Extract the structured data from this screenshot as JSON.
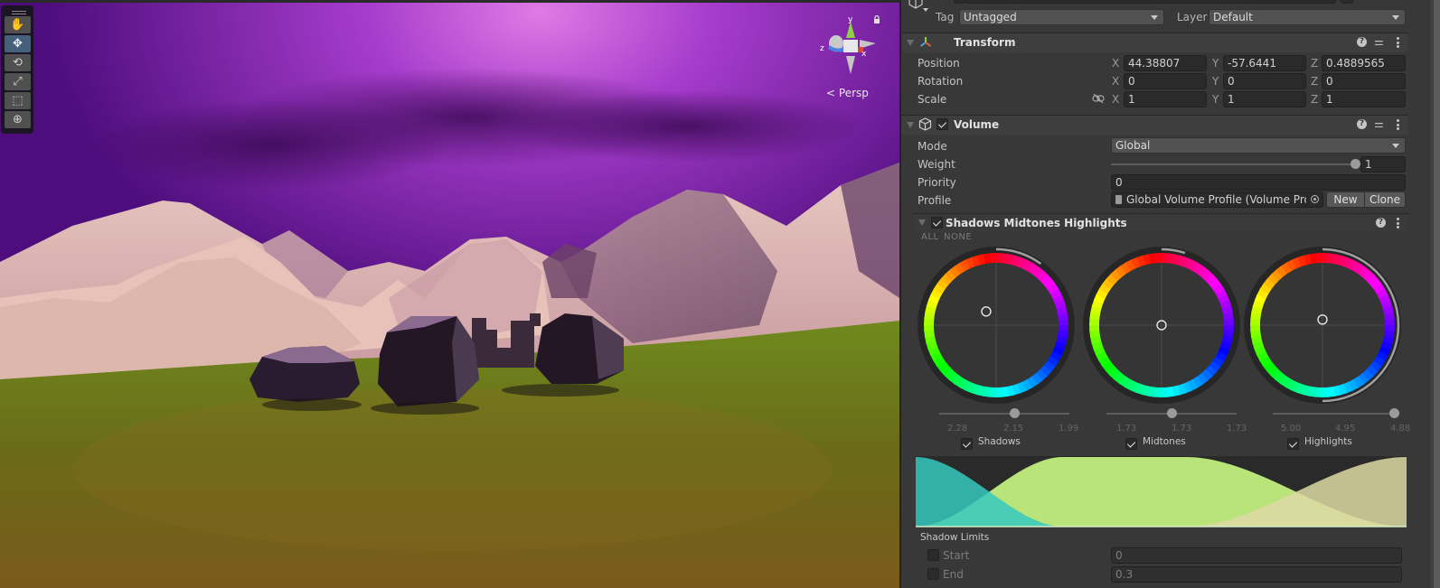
{
  "scene_view": {
    "camera_label": "Persp",
    "gizmo_axes": {
      "x": "x",
      "y": "y",
      "z": "z"
    },
    "tools": [
      {
        "name": "hand-tool",
        "icon": "hand-icon",
        "active": false
      },
      {
        "name": "move-tool",
        "icon": "move-arrows-icon",
        "active": true
      },
      {
        "name": "rotate-tool",
        "icon": "rotate-icon",
        "active": false
      },
      {
        "name": "scale-tool",
        "icon": "scale-icon",
        "active": false
      },
      {
        "name": "rect-tool",
        "icon": "rect-transform-icon",
        "active": false
      },
      {
        "name": "transform-tool",
        "icon": "transform-gizmo-icon",
        "active": false
      }
    ]
  },
  "inspector": {
    "tag_label": "Tag",
    "tag_value": "Untagged",
    "layer_label": "Layer",
    "layer_value": "Default",
    "transform": {
      "title": "Transform",
      "rows": [
        {
          "label": "Position",
          "x": "44.38807",
          "y": "-57.6441",
          "z": "0.4889565"
        },
        {
          "label": "Rotation",
          "x": "0",
          "y": "0",
          "z": "0"
        },
        {
          "label": "Scale",
          "x": "1",
          "y": "1",
          "z": "1"
        }
      ],
      "axis_labels": {
        "x": "X",
        "y": "Y",
        "z": "Z"
      }
    },
    "volume": {
      "title": "Volume",
      "enabled": true,
      "mode_label": "Mode",
      "mode_value": "Global",
      "weight_label": "Weight",
      "weight_value": "1",
      "weight_fraction": 1.0,
      "priority_label": "Priority",
      "priority_value": "0",
      "profile_label": "Profile",
      "profile_value": "Global Volume Profile (Volume Profil",
      "new_button": "New",
      "clone_button": "Clone"
    },
    "smh": {
      "title": "Shadows Midtones Highlights",
      "enabled": true,
      "all_label": "ALL",
      "none_label": "NONE",
      "wheels": [
        {
          "name": "Shadows",
          "checked": true,
          "ticks": [
            "2.28",
            "2.15",
            "1.99"
          ],
          "slider_fraction": 0.58,
          "ring_fraction": 0.1,
          "cursor": [
            -0.16,
            0.22
          ]
        },
        {
          "name": "Midtones",
          "checked": true,
          "ticks": [
            "1.73",
            "1.73",
            "1.73"
          ],
          "slider_fraction": 0.5,
          "ring_fraction": 0.05,
          "cursor": [
            0,
            0
          ]
        },
        {
          "name": "Highlights",
          "checked": true,
          "ticks": [
            "5.00",
            "4.95",
            "4.88"
          ],
          "slider_fraction": 1.0,
          "ring_fraction": 0.5,
          "cursor": [
            0,
            0.09
          ]
        }
      ],
      "shadow_limits_label": "Shadow Limits",
      "start_label": "Start",
      "start_value": "0",
      "start_checked": false,
      "end_label": "End",
      "end_value": "0.3",
      "end_checked": false,
      "curve_colors": {
        "shadows": "#35c9be",
        "midtones": "#b8e479",
        "highlights": "#ddd9a3"
      }
    }
  }
}
